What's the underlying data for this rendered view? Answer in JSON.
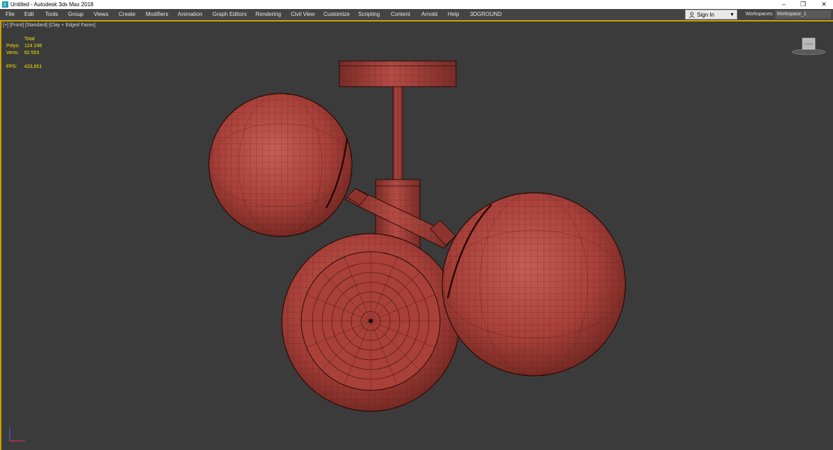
{
  "window": {
    "title": "Untitled - Autodesk 3ds Max 2018",
    "controls": {
      "minimize": "–",
      "restore": "❐",
      "close": "✕"
    }
  },
  "menubar": {
    "items": [
      "File",
      "Edit",
      "Tools",
      "Group",
      "Views",
      "Create",
      "Modifiers",
      "Animation",
      "Graph Editors",
      "Rendering",
      "Civil View",
      "Customize",
      "Scripting",
      "Content",
      "Arnold",
      "Help",
      "3DGROUND"
    ],
    "sign_in": "Sign In",
    "workspaces_label": "Workspaces:",
    "workspace_value": "Workspace_1"
  },
  "viewport": {
    "label_parts": [
      "[+]",
      "[Front]",
      "[Standard]",
      "[Clay + Edged Faces]"
    ],
    "stats": {
      "header": "Total",
      "polys_label": "Polys:",
      "polys_value": "124 248",
      "verts_label": "Verts:",
      "verts_value": "62 553",
      "fps_label": "FPS:",
      "fps_value": "433,651"
    },
    "viewcube_label": "FRONT"
  },
  "colors": {
    "viewport_bg": "#3b3b3b",
    "active_border": "#c9a400",
    "stats_text": "#f1e300",
    "model_red": "#a8403a"
  }
}
